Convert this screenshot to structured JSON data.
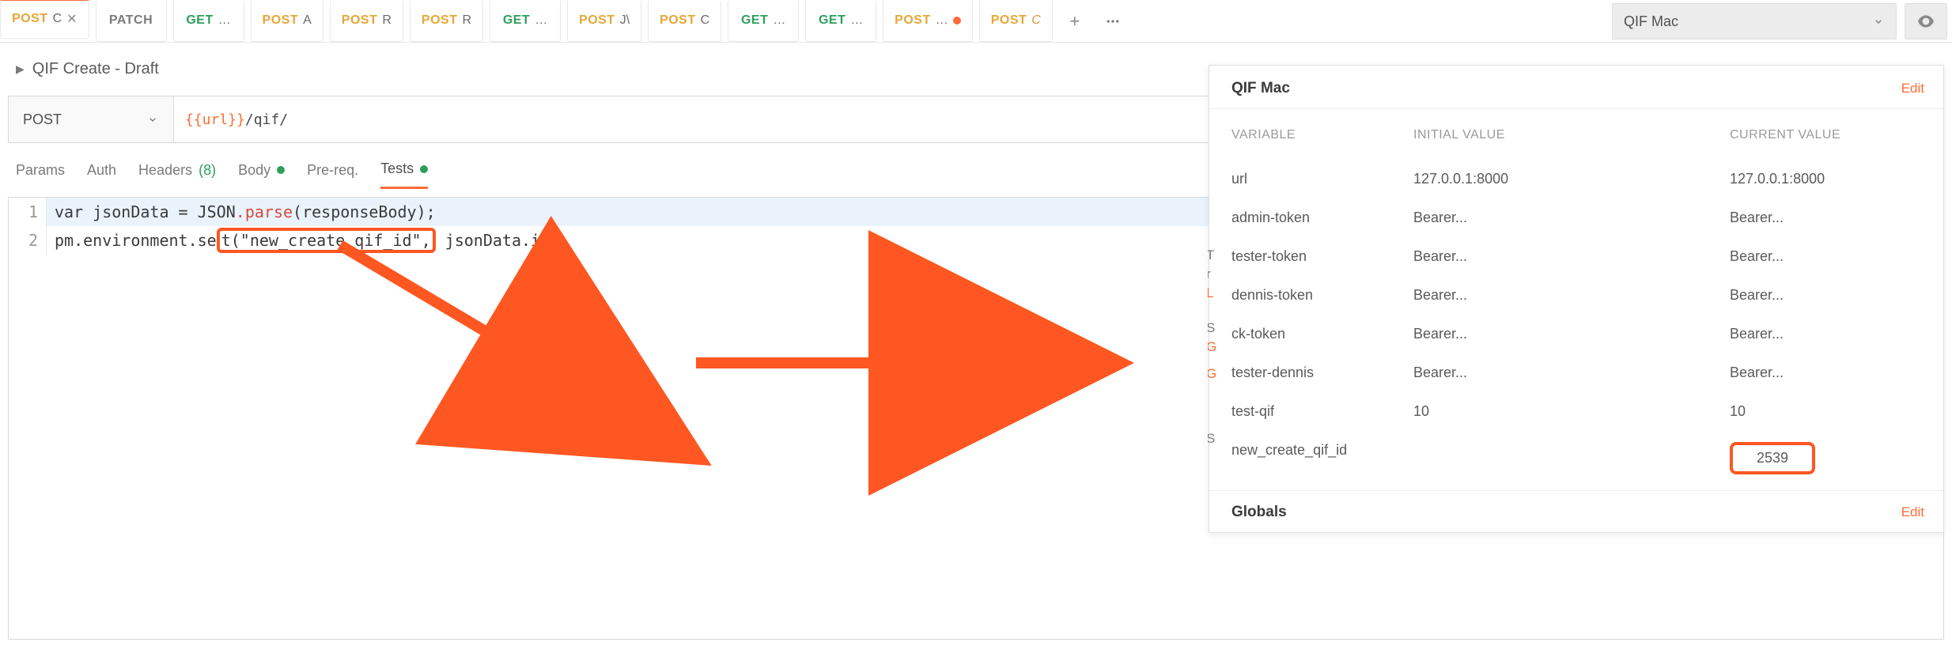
{
  "env_selector": {
    "name": "QIF Mac"
  },
  "tabs": [
    {
      "method": "POST",
      "cls": "method-post",
      "name": " C",
      "nameItalic": false,
      "close": true,
      "active": true,
      "dot": false
    },
    {
      "method": "PATCH",
      "cls": "method-patch",
      "name": "",
      "nameItalic": false,
      "close": false,
      "active": false,
      "dot": false
    },
    {
      "method": "GET",
      "cls": "method-get",
      "name": " …",
      "nameItalic": false,
      "close": false,
      "active": false,
      "dot": false
    },
    {
      "method": "POST",
      "cls": "method-post",
      "name": " A",
      "nameItalic": false,
      "close": false,
      "active": false,
      "dot": false
    },
    {
      "method": "POST",
      "cls": "method-post",
      "name": " R",
      "nameItalic": false,
      "close": false,
      "active": false,
      "dot": false
    },
    {
      "method": "POST",
      "cls": "method-post",
      "name": " R",
      "nameItalic": false,
      "close": false,
      "active": false,
      "dot": false
    },
    {
      "method": "GET",
      "cls": "method-get",
      "name": " …",
      "nameItalic": false,
      "close": false,
      "active": false,
      "dot": false
    },
    {
      "method": "POST",
      "cls": "method-post",
      "name": " J\\",
      "nameItalic": false,
      "close": false,
      "active": false,
      "dot": false
    },
    {
      "method": "POST",
      "cls": "method-post",
      "name": " C",
      "nameItalic": false,
      "close": false,
      "active": false,
      "dot": false
    },
    {
      "method": "GET",
      "cls": "method-get",
      "name": " …",
      "nameItalic": false,
      "close": false,
      "active": false,
      "dot": false
    },
    {
      "method": "GET",
      "cls": "method-get",
      "name": " …",
      "nameItalic": false,
      "close": false,
      "active": false,
      "dot": false
    },
    {
      "method": "POST",
      "cls": "method-post",
      "name": " …",
      "nameItalic": false,
      "close": false,
      "active": false,
      "dot": true
    },
    {
      "method": "POST",
      "cls": "method-post",
      "name": " C",
      "nameItalic": true,
      "close": false,
      "active": false,
      "dot": false
    }
  ],
  "breadcrumb": {
    "title": "QIF Create - Draft"
  },
  "request": {
    "method": "POST",
    "url_var": "{{url}}",
    "url_suffix": "/qif/"
  },
  "subtabs": {
    "params": "Params",
    "auth": "Auth",
    "headers": "Headers",
    "headers_count": "(8)",
    "body": "Body",
    "prereq": "Pre-req.",
    "tests": "Tests"
  },
  "code": {
    "line1_a": "var jsonData = JSON",
    "line1_b": ".parse",
    "line1_c": "(responseBody);",
    "line2_a": "pm.environment.se",
    "line2_b": "t(\"new_create_qif_id\",",
    "line2_c": " jsonData.id);"
  },
  "env_popover": {
    "title": "QIF Mac",
    "edit": "Edit",
    "th_variable": "VARIABLE",
    "th_initial": "INITIAL VALUE",
    "th_current": "CURRENT VALUE",
    "rows": [
      {
        "variable": "url",
        "initial": "127.0.0.1:8000",
        "current": "127.0.0.1:8000",
        "highlight": false
      },
      {
        "variable": "admin-token",
        "initial": "Bearer...",
        "current": "Bearer...",
        "highlight": false
      },
      {
        "variable": "tester-token",
        "initial": "Bearer...",
        "current": "Bearer...",
        "highlight": false
      },
      {
        "variable": "dennis-token",
        "initial": "Bearer...",
        "current": "Bearer...",
        "highlight": false
      },
      {
        "variable": "ck-token",
        "initial": "Bearer...",
        "current": "Bearer...",
        "highlight": false
      },
      {
        "variable": "tester-dennis",
        "initial": "Bearer...",
        "current": "Bearer...",
        "highlight": false
      },
      {
        "variable": "test-qif",
        "initial": "10",
        "current": "10",
        "highlight": false
      },
      {
        "variable": "new_create_qif_id",
        "initial": "",
        "current": "2539",
        "highlight": true
      }
    ],
    "globals": "Globals",
    "globals_edit": "Edit"
  },
  "frag": {
    "t": "T",
    "r": "r",
    "l": "L",
    "s1": "S",
    "g1": "G",
    "g2": "G",
    "s2": "S"
  }
}
